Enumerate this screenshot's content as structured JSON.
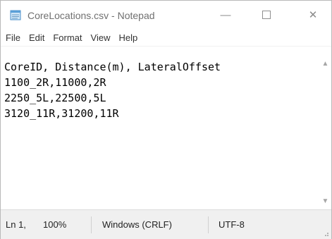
{
  "window": {
    "title": "CoreLocations.csv - Notepad",
    "icon": "notepad-icon",
    "controls": {
      "minimize": "—",
      "close": "✕"
    }
  },
  "menubar": {
    "items": [
      "File",
      "Edit",
      "Format",
      "View",
      "Help"
    ]
  },
  "editor": {
    "lines": [
      "CoreID, Distance(m), LateralOffset",
      "1100_2R,11000,2R",
      "2250_5L,22500,5L",
      "3120_11R,31200,11R"
    ]
  },
  "scrollbar": {
    "up": "▲",
    "down": "▼"
  },
  "statusbar": {
    "position": "Ln 1,",
    "zoom": "100%",
    "line_ending": "Windows (CRLF)",
    "encoding": "UTF-8"
  },
  "colors": {
    "title_text": "#707070",
    "statusbar_bg": "#f0f0f0"
  }
}
